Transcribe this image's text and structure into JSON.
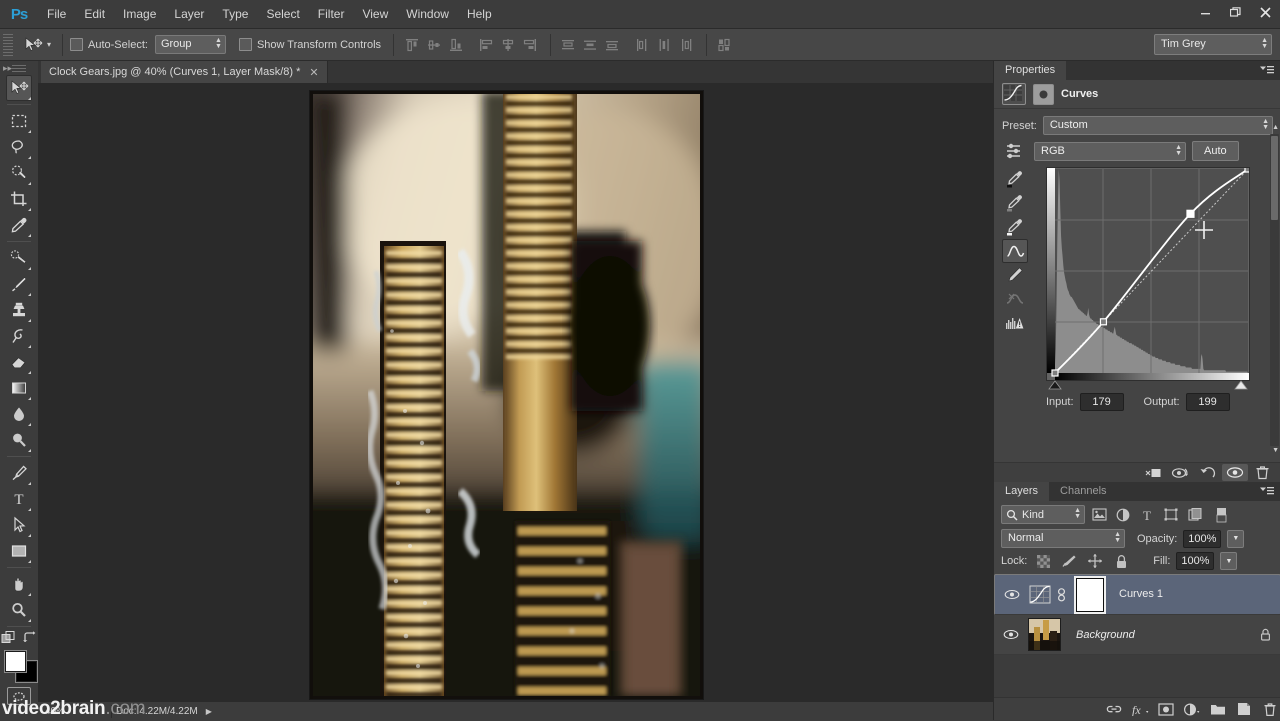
{
  "app": {
    "logo": "Ps",
    "menus": [
      "File",
      "Edit",
      "Image",
      "Layer",
      "Type",
      "Select",
      "Filter",
      "View",
      "Window",
      "Help"
    ],
    "window_buttons": {
      "minimize": "—",
      "restore": "❐",
      "close": "✕"
    }
  },
  "options_bar": {
    "tool_name": "move-tool",
    "auto_select_label": "Auto-Select:",
    "auto_select_checked": false,
    "auto_select_value": "Group",
    "show_transform_label": "Show Transform Controls",
    "show_transform_checked": false,
    "workspace": "Tim Grey",
    "align_icons": [
      "align-top-edges",
      "align-vertical-centers",
      "align-bottom-edges",
      "align-left-edges",
      "align-horizontal-centers",
      "align-right-edges",
      "distribute-top-edges",
      "distribute-vertical-centers",
      "distribute-bottom-edges",
      "distribute-left-edges",
      "distribute-horizontal-centers",
      "distribute-right-edges",
      "auto-align-layers"
    ]
  },
  "document": {
    "tab_title": "Clock Gears.jpg @ 40% (Curves 1, Layer Mask/8) *",
    "close_glyph": "✕",
    "zoom_level": "40%"
  },
  "toolbar": {
    "tools": [
      {
        "name": "move-tool",
        "active": true
      },
      {
        "name": "rectangular-marquee-tool",
        "active": false
      },
      {
        "name": "lasso-tool",
        "active": false
      },
      {
        "name": "quick-selection-tool",
        "active": false
      },
      {
        "name": "crop-tool",
        "active": false
      },
      {
        "name": "eyedropper-tool",
        "active": false
      },
      {
        "name": "spot-healing-brush-tool",
        "active": false
      },
      {
        "name": "brush-tool",
        "active": false
      },
      {
        "name": "clone-stamp-tool",
        "active": false
      },
      {
        "name": "history-brush-tool",
        "active": false
      },
      {
        "name": "eraser-tool",
        "active": false
      },
      {
        "name": "gradient-tool",
        "active": false
      },
      {
        "name": "blur-tool",
        "active": false
      },
      {
        "name": "dodge-tool",
        "active": false
      },
      {
        "name": "pen-tool",
        "active": false
      },
      {
        "name": "type-tool",
        "active": false
      },
      {
        "name": "path-selection-tool",
        "active": false
      },
      {
        "name": "rectangle-tool",
        "active": false
      },
      {
        "name": "hand-tool",
        "active": false
      },
      {
        "name": "zoom-tool",
        "active": false
      }
    ],
    "foreground_color": "#ffffff",
    "background_color": "#000000"
  },
  "status_bar": {
    "zoom": "40%",
    "doc_info": "Doc: 4.22M/4.22M",
    "arrow_glyph": "▶"
  },
  "watermark": {
    "primary": "video2brain",
    "secondary": ".com"
  },
  "properties_panel": {
    "tab_label": "Properties",
    "adjustment_title": "Curves",
    "preset_label": "Preset:",
    "preset_value": "Custom",
    "channel_value": "RGB",
    "auto_button": "Auto",
    "input_label": "Input:",
    "input_value": "179",
    "output_label": "Output:",
    "output_value": "199",
    "curve_tools": [
      {
        "name": "black-point-eyedropper-icon",
        "active": false
      },
      {
        "name": "gray-point-eyedropper-icon",
        "active": false
      },
      {
        "name": "white-point-eyedropper-icon",
        "active": false
      },
      {
        "name": "curve-point-tool-icon",
        "active": true
      },
      {
        "name": "pencil-draw-curve-icon",
        "active": false
      },
      {
        "name": "smooth-curve-icon",
        "active": false
      },
      {
        "name": "histogram-options-icon",
        "active": false
      }
    ],
    "footer_icons": [
      {
        "name": "clip-to-layer-icon",
        "active": false
      },
      {
        "name": "view-previous-state-icon",
        "active": false
      },
      {
        "name": "reset-adjustment-icon",
        "active": false
      },
      {
        "name": "toggle-layer-visibility-icon",
        "active": true
      },
      {
        "name": "delete-adjustment-layer-icon",
        "active": false
      }
    ]
  },
  "chart_data": {
    "type": "line",
    "title": "Curves (RGB)",
    "xlabel": "Input",
    "ylabel": "Output",
    "xlim": [
      0,
      255
    ],
    "ylim": [
      0,
      255
    ],
    "grid": true,
    "curve_points": [
      {
        "input": 0,
        "output": 0,
        "selected": false
      },
      {
        "input": 64,
        "output": 64,
        "selected": false
      },
      {
        "input": 179,
        "output": 199,
        "selected": true
      },
      {
        "input": 255,
        "output": 255,
        "selected": false
      }
    ],
    "baseline": {
      "from": [
        0,
        0
      ],
      "to": [
        255,
        255
      ]
    },
    "histogram": [
      6,
      18,
      52,
      96,
      128,
      150,
      141,
      120,
      101,
      92,
      86,
      79,
      74,
      71,
      68,
      66,
      63,
      61,
      60,
      58,
      57,
      56,
      56,
      55,
      54,
      53,
      52,
      51,
      50,
      49,
      48,
      47,
      47,
      46,
      46,
      45,
      45,
      44,
      44,
      43,
      43,
      42,
      42,
      44,
      48,
      43,
      41,
      40,
      40,
      39,
      39,
      38,
      38,
      37,
      37,
      36,
      36,
      36,
      35,
      35,
      35,
      34,
      34,
      34,
      33,
      33,
      33,
      32,
      32,
      32,
      31,
      31,
      31,
      30,
      30,
      30,
      29,
      29,
      32,
      34,
      31,
      28,
      28,
      27,
      27,
      27,
      26,
      26,
      26,
      25,
      25,
      25,
      24,
      24,
      24,
      23,
      23,
      23,
      22,
      22,
      22,
      22,
      21,
      21,
      21,
      20,
      20,
      20,
      19,
      19,
      19,
      18,
      18,
      18,
      17,
      17,
      17,
      16,
      16,
      16,
      15,
      15,
      15,
      14,
      14,
      14,
      13,
      13,
      13,
      12,
      12,
      12,
      12,
      11,
      11,
      11,
      11,
      10,
      10,
      10,
      10,
      10,
      9,
      9,
      9,
      9,
      9,
      8,
      8,
      8,
      8,
      8,
      8,
      7,
      7,
      7,
      7,
      7,
      7,
      6,
      6,
      6,
      6,
      6,
      6,
      6,
      5,
      5,
      5,
      5,
      5,
      5,
      5,
      4,
      4,
      4,
      4,
      4,
      4,
      4,
      4,
      3,
      3,
      3,
      3,
      3,
      3,
      3,
      3,
      3,
      3,
      3,
      3,
      12,
      14,
      10,
      3,
      2,
      2,
      2,
      2,
      2,
      2,
      2,
      2,
      2,
      2,
      2,
      2,
      2,
      2,
      2,
      2,
      2,
      2,
      2,
      2,
      2,
      2,
      2,
      2,
      2,
      2,
      2,
      2,
      2,
      1,
      1,
      1,
      1,
      1,
      1,
      1,
      1,
      1,
      1,
      1,
      1,
      1,
      1,
      1,
      1,
      1,
      1,
      1,
      1,
      1,
      1,
      1,
      1,
      1,
      1,
      1,
      1,
      1,
      0
    ]
  },
  "layers_panel": {
    "tabs": [
      {
        "label": "Layers",
        "active": true
      },
      {
        "label": "Channels",
        "active": false
      }
    ],
    "filter_label": "Kind",
    "filter_icons": [
      "filter-pixel-layers-icon",
      "filter-adjustment-layers-icon",
      "filter-type-layers-icon",
      "filter-shape-layers-icon",
      "filter-smart-objects-icon"
    ],
    "blend_mode": "Normal",
    "opacity_label": "Opacity:",
    "opacity_value": "100%",
    "lock_label": "Lock:",
    "lock_icons": [
      "lock-transparent-pixels-icon",
      "lock-image-pixels-icon",
      "lock-position-icon",
      "lock-all-icon"
    ],
    "fill_label": "Fill:",
    "fill_value": "100%",
    "layers": [
      {
        "name": "Curves 1",
        "selected": true,
        "visible": true,
        "locked": false,
        "italic": false,
        "has_mask": true
      },
      {
        "name": "Background",
        "selected": false,
        "visible": true,
        "locked": true,
        "italic": true,
        "has_mask": false
      }
    ],
    "footer_icons": [
      "link-layers-icon",
      "layer-style-fx-icon",
      "add-layer-mask-icon",
      "new-adjustment-layer-icon",
      "new-group-icon",
      "new-layer-icon",
      "delete-layer-icon"
    ]
  }
}
